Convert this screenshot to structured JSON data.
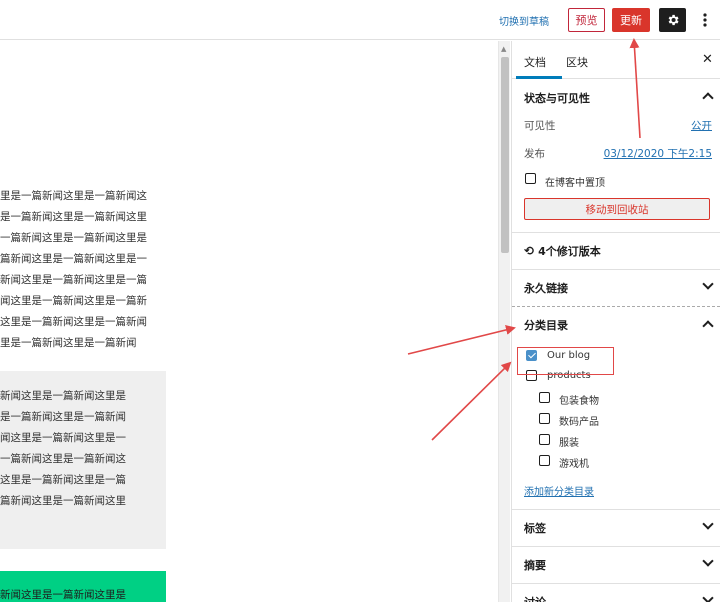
{
  "topbar": {
    "switch_draft": "切换到草稿",
    "preview": "预览",
    "update": "更新",
    "gear_icon": "gear-icon",
    "more_icon": "more-vertical-icon"
  },
  "editor": {
    "para_lines": [
      "里是一篇新闻这里是一篇新闻这",
      "是一篇新闻这里是一篇新闻这里",
      "一篇新闻这里是一篇新闻这里是",
      "篇新闻这里是一篇新闻这里是一",
      "新闻这里是一篇新闻这里是一篇",
      "闻这里是一篇新闻这里是一篇新",
      "这里是一篇新闻这里是一篇新闻",
      "里是一篇新闻这里是一篇新闻"
    ],
    "grey_lines": [
      "新闻这里是一篇新闻这里是",
      "是一篇新闻这里是一篇新闻",
      "闻这里是一篇新闻这里是一",
      "一篇新闻这里是一篇新闻这",
      "这里是一篇新闻这里是一篇",
      "篇新闻这里是一篇新闻这里"
    ],
    "green_line": "新闻这里是一篇新闻这里是"
  },
  "sidebar": {
    "tabs": [
      "文档",
      "区块"
    ],
    "close_icon": "close-icon",
    "status": {
      "title": "状态与可见性",
      "visibility_label": "可见性",
      "visibility_value": "公开",
      "publish_label": "发布",
      "publish_value": "03/12/2020 下午2:15",
      "sticky_label": "在博客中置顶",
      "trash_label": "移动到回收站"
    },
    "revisions": "4个修订版本",
    "permalink": "永久链接",
    "categories": {
      "title": "分类目录",
      "items": [
        {
          "label": "Our blog",
          "checked": true,
          "level": 0
        },
        {
          "label": "products",
          "checked": false,
          "level": 0
        },
        {
          "label": "包装食物",
          "checked": false,
          "level": 1
        },
        {
          "label": "数码产品",
          "checked": false,
          "level": 1
        },
        {
          "label": "服装",
          "checked": false,
          "level": 1
        },
        {
          "label": "游戏机",
          "checked": false,
          "level": 1
        }
      ],
      "add_new": "添加新分类目录"
    },
    "tags": "标签",
    "excerpt": "摘要",
    "discussion": "讨论"
  },
  "colors": {
    "accent": "#007cba",
    "danger": "#d9352b",
    "annotation": "#e14848",
    "green_block": "#00d084"
  }
}
